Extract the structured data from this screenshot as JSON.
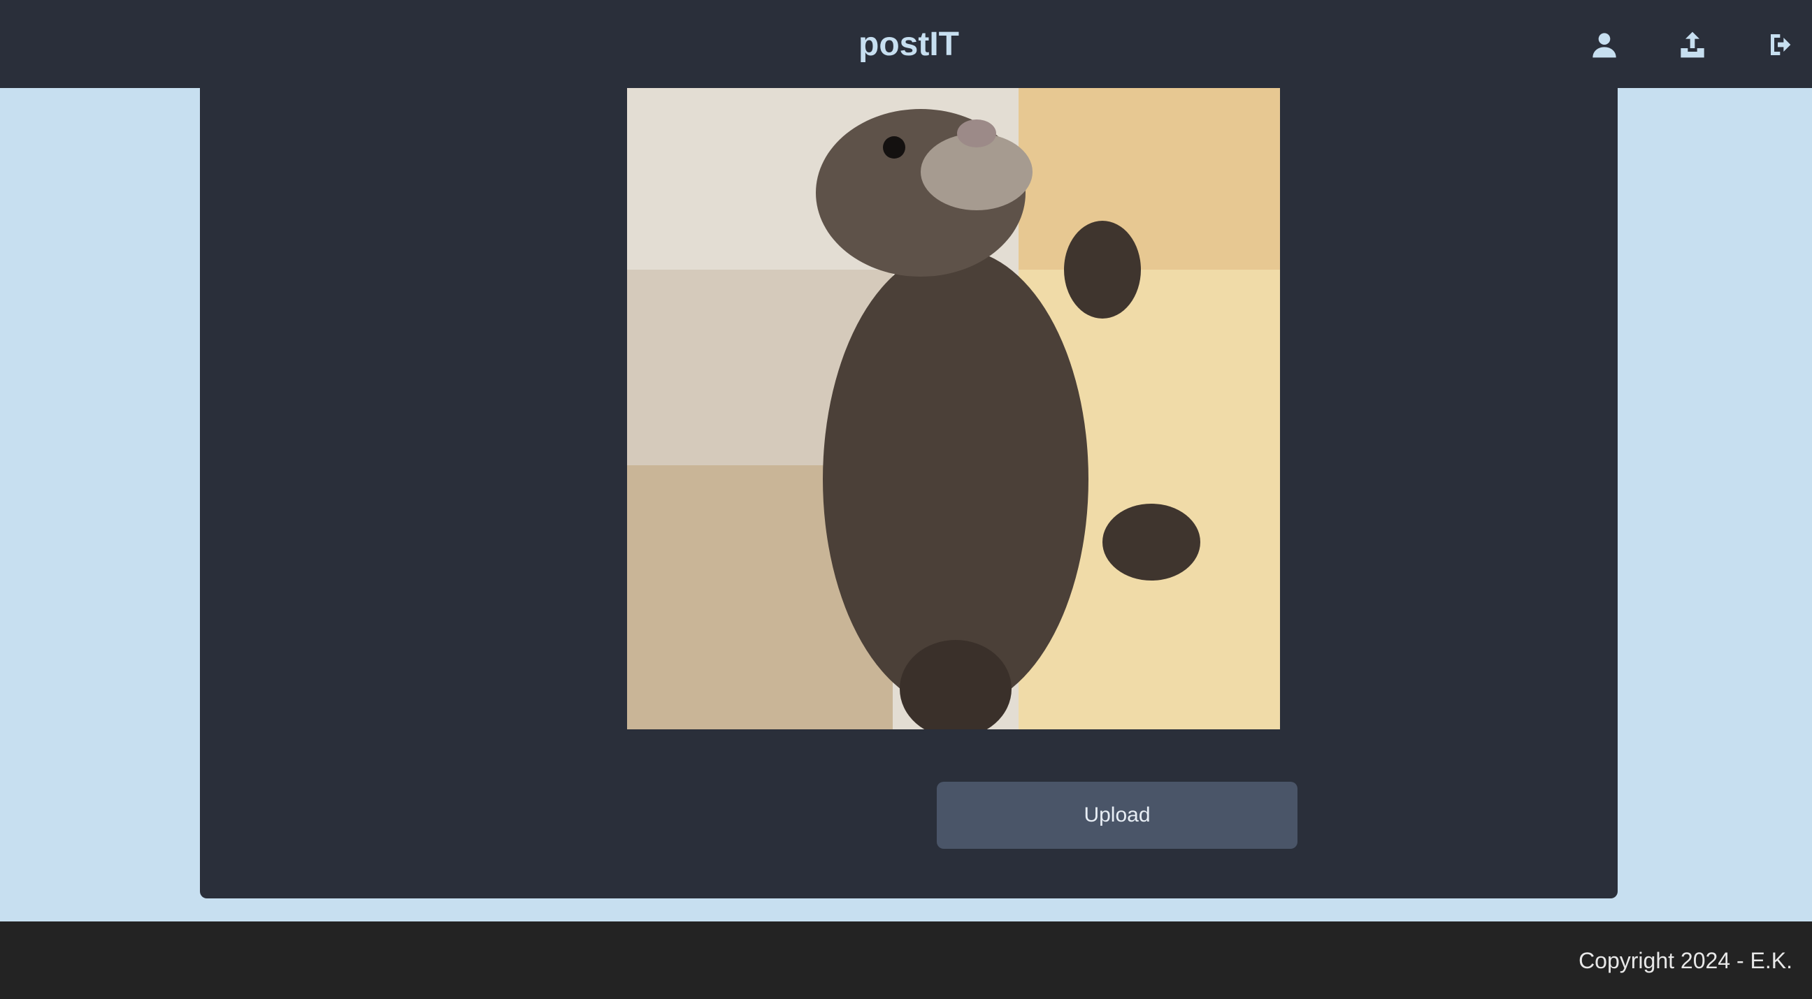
{
  "header": {
    "brand": "postIT",
    "icons": [
      "user-icon",
      "upload-icon",
      "logout-icon"
    ]
  },
  "preview": {
    "subject": "otter-photo"
  },
  "actions": {
    "upload_label": "Upload"
  },
  "footer": {
    "copyright": "Copyright 2024 - E.K."
  },
  "colors": {
    "header_bg": "#2a2f3a",
    "page_bg": "#c7dff0",
    "button_bg": "#4a5568",
    "footer_bg": "#232323"
  }
}
